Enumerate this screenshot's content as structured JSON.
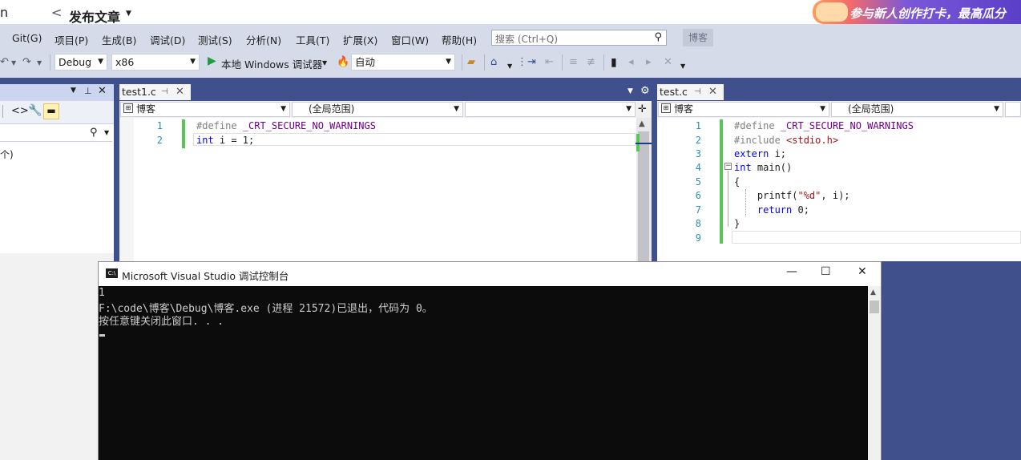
{
  "top": {
    "back_glyph": "<",
    "page_title": "发布文章",
    "left_fragment": "n",
    "banner_text": "参与新人创作打卡，最高瓜分"
  },
  "menu": {
    "items": [
      "Git(G)",
      "项目(P)",
      "生成(B)",
      "调试(D)",
      "测试(S)",
      "分析(N)",
      "工具(T)",
      "扩展(X)",
      "窗口(W)",
      "帮助(H)"
    ],
    "search_placeholder": "搜索 (Ctrl+Q)",
    "solution_badge": "博客"
  },
  "toolbar": {
    "config": "Debug",
    "platform": "x86",
    "run_label": "本地 Windows 调试器",
    "auto_label": "自动"
  },
  "left_panel": {
    "item_text": "个)"
  },
  "editor_left": {
    "tab_title": "test1.c",
    "scope_project": "博客",
    "scope_global": "(全局范围)",
    "lines": [
      "1",
      "2"
    ]
  },
  "editor_right": {
    "tab_title": "test.c",
    "scope_project": "博客",
    "scope_global": "(全局范围)",
    "lines": [
      "1",
      "2",
      "3",
      "4",
      "5",
      "6",
      "7",
      "8",
      "9"
    ]
  },
  "console": {
    "title": "Microsoft Visual Studio 调试控制台",
    "icon_text": "C:\\",
    "line1": "1",
    "line2": "F:\\code\\博客\\Debug\\博客.exe (进程 21572)已退出，代码为 0。",
    "line3": "按任意键关闭此窗口. . ."
  }
}
